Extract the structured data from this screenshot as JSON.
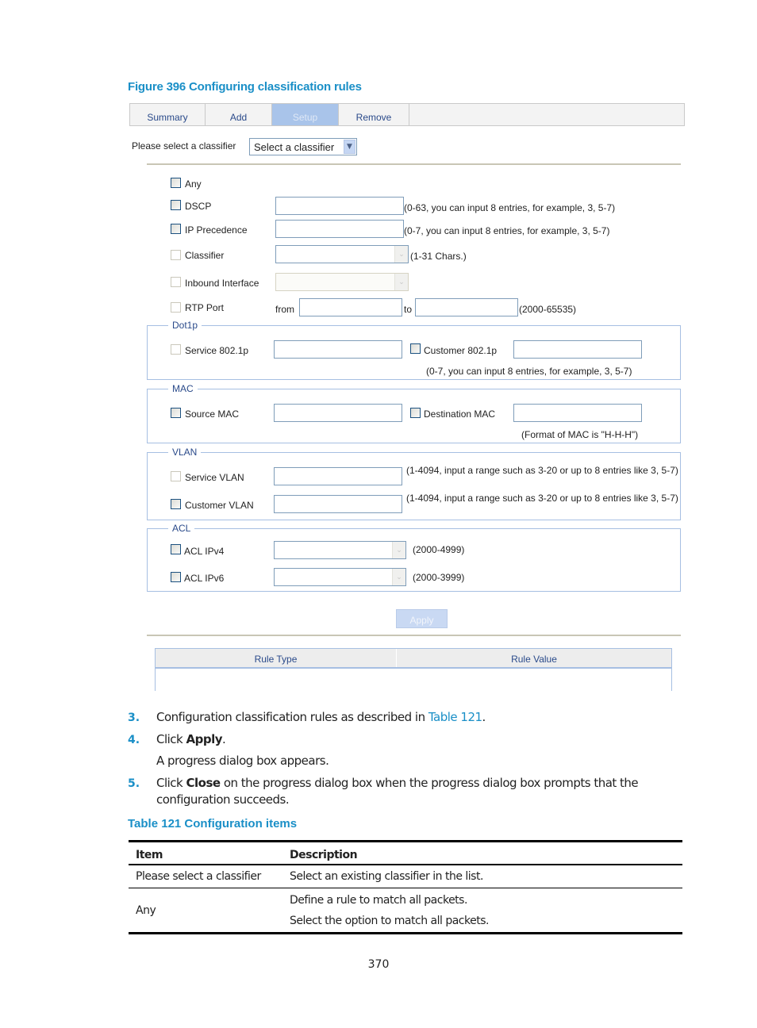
{
  "figure_caption": "Figure 396 Configuring classification rules",
  "tabs": [
    {
      "label": "Summary",
      "active": false
    },
    {
      "label": "Add",
      "active": false
    },
    {
      "label": "Setup",
      "active": true
    },
    {
      "label": "Remove",
      "active": false
    }
  ],
  "classifier_select": {
    "label": "Please select a classifier",
    "value": "Select a classifier"
  },
  "rules": {
    "any": {
      "label": "Any"
    },
    "dscp": {
      "label": "DSCP",
      "hint": "(0-63, you can input 8 entries, for example, 3, 5-7)",
      "value": ""
    },
    "ip_precedence": {
      "label": "IP Precedence",
      "hint": "(0-7, you can input 8 entries, for example, 3, 5-7)",
      "value": ""
    },
    "classifier": {
      "label": "Classifier",
      "hint": "(1-31 Chars.)",
      "value": ""
    },
    "inbound_interface": {
      "label": "Inbound Interface",
      "value": ""
    },
    "rtp_port": {
      "label": "RTP Port",
      "from_label": "from",
      "to_label": "to",
      "hint": "(2000-65535)",
      "from_value": "",
      "to_value": ""
    }
  },
  "groups": {
    "dot1p": {
      "legend": "Dot1p",
      "service_label": "Service 802.1p",
      "customer_label": "Customer 802.1p",
      "hint": "(0-7, you can input 8 entries, for example, 3, 5-7)"
    },
    "mac": {
      "legend": "MAC",
      "source_label": "Source MAC",
      "destination_label": "Destination MAC",
      "hint": "(Format of MAC is \"H-H-H\")"
    },
    "vlan": {
      "legend": "VLAN",
      "service_label": "Service VLAN",
      "service_hint": "(1-4094, input a range such as 3-20 or up to 8 entries like 3, 5-7)",
      "customer_label": "Customer VLAN",
      "customer_hint": "(1-4094, input a range such as 3-20 or up to 8 entries like 3, 5-7)"
    },
    "acl": {
      "legend": "ACL",
      "ipv4_label": "ACL IPv4",
      "ipv4_hint": "(2000-4999)",
      "ipv6_label": "ACL IPv6",
      "ipv6_hint": "(2000-3999)"
    }
  },
  "apply_button": "Apply",
  "rule_table": {
    "columns": [
      "Rule Type",
      "Rule Value"
    ],
    "rows": []
  },
  "steps": [
    {
      "num": "3.",
      "pre": "Configuration classification rules as described in ",
      "link": "Table 121",
      "post": "."
    },
    {
      "num": "4.",
      "pre": "Click ",
      "bold": "Apply",
      "post": ".",
      "sub": "A progress dialog box appears."
    },
    {
      "num": "5.",
      "pre": "Click ",
      "bold": "Close",
      "post": " on the progress dialog box when the progress dialog box prompts that the",
      "line2": "configuration succeeds."
    }
  ],
  "table_caption": "Table 121 Configuration items",
  "config_table": {
    "headers": [
      "Item",
      "Description"
    ],
    "rows": [
      {
        "item": "Please select a classifier",
        "description": [
          "Select an existing classifier in the list."
        ]
      },
      {
        "item": "Any",
        "description": [
          "Define a rule to match all packets.",
          "Select the option to match all packets."
        ]
      }
    ]
  },
  "page_number": "370"
}
